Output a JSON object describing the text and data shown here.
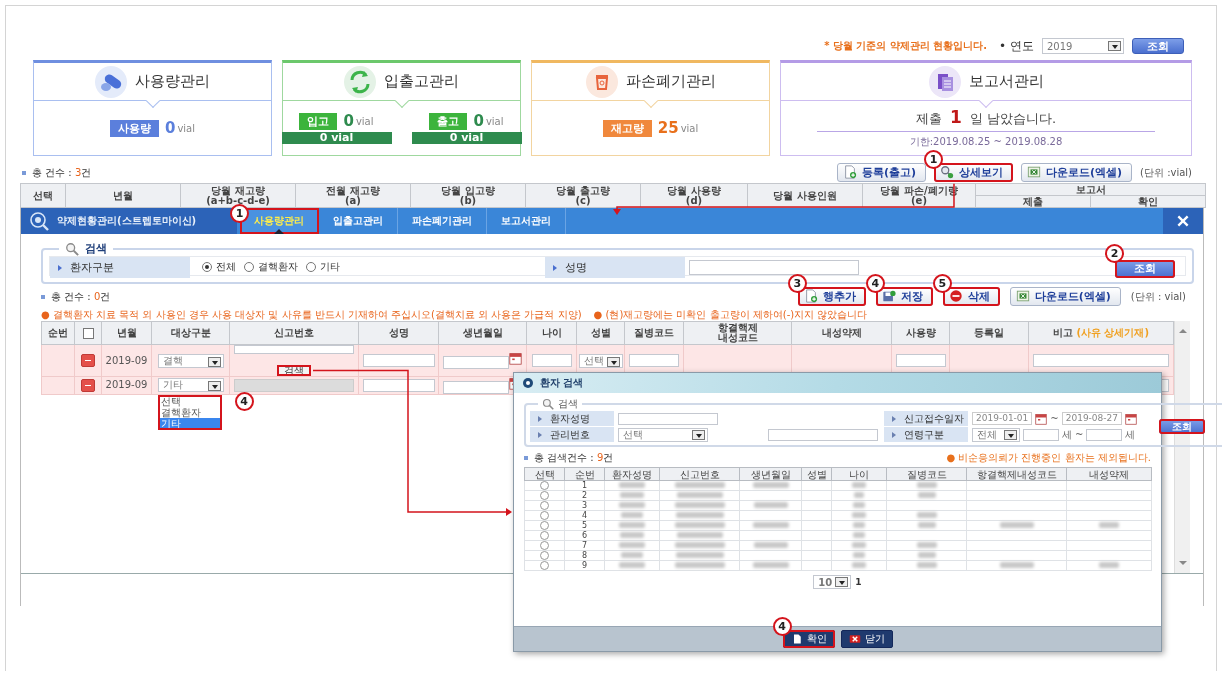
{
  "header": {
    "notice": "* 당월 기준의 약제관리 현황입니다.",
    "year_label": "• 연도",
    "year": "2019",
    "search_button": "조회"
  },
  "cards": [
    {
      "kind": "usage",
      "title": "사용량관리",
      "stats": [
        {
          "label": "사용량",
          "value": "0",
          "unit": "vial"
        }
      ]
    },
    {
      "kind": "inout",
      "title": "입출고관리",
      "stats": [
        {
          "label": "입고",
          "value": "0",
          "unit": "vial",
          "bar": "0 vial"
        },
        {
          "label": "출고",
          "value": "0",
          "unit": "vial",
          "bar": "0 vial"
        }
      ]
    },
    {
      "kind": "disposal",
      "title": "파손폐기관리",
      "stats": [
        {
          "label": "재고량",
          "value": "25",
          "unit": "vial"
        }
      ]
    },
    {
      "kind": "report",
      "title": "보고서관리",
      "message": "제출 **1** 일 남았습니다.",
      "period": "기한:2019.08.25 ~ 2019.08.28"
    }
  ],
  "summary": {
    "count_prefix": "총 건수 : ",
    "count": "3",
    "count_suffix": "건",
    "buttons": [
      {
        "kind": "register",
        "label": "등록(출고)",
        "highlighted": false
      },
      {
        "kind": "detail",
        "label": "상세보기",
        "highlighted": true,
        "callout": "1"
      },
      {
        "kind": "download",
        "label": "다운로드(엑셀)",
        "highlighted": false
      }
    ],
    "unit": "(단위 :vial)",
    "columns": [
      {
        "label": "선택"
      },
      {
        "label": "년월"
      },
      {
        "label": "당월 재고량",
        "sub": "(a+b-c-d-e)"
      },
      {
        "label": "전월 재고량",
        "sub": "(a)"
      },
      {
        "label": "당월 입고량",
        "sub": "(b)"
      },
      {
        "label": "당월 출고량",
        "sub": "(c)"
      },
      {
        "label": "당월 사용량",
        "sub": "(d)"
      },
      {
        "label": "당월 사용인원"
      },
      {
        "label": "당월 파손/폐기량",
        "sub": "(e)"
      },
      {
        "label": "보고서",
        "children": [
          "제출",
          "확인"
        ]
      }
    ]
  },
  "layer": {
    "title": "약제현황관리(스트렙토마이신)",
    "tabs": [
      {
        "label": "사용량관리",
        "selected": true,
        "highlighted": true,
        "callout": "1"
      },
      {
        "label": "입출고관리",
        "selected": false,
        "highlighted": false
      },
      {
        "label": "파손폐기관리",
        "selected": false,
        "highlighted": false
      },
      {
        "label": "보고서관리",
        "selected": false,
        "highlighted": false
      }
    ],
    "search": {
      "legend": "검색",
      "type_label": "환자구분",
      "types": [
        {
          "label": "전체",
          "selected": true
        },
        {
          "label": "결핵환자",
          "selected": false
        },
        {
          "label": "기타",
          "selected": false
        }
      ],
      "name_label": "성명",
      "button": {
        "label": "조회",
        "highlighted": true,
        "callout": "2"
      }
    },
    "count_prefix": "총 건수 : ",
    "count": "0",
    "count_suffix": "건",
    "buttons": [
      {
        "kind": "insert",
        "label": "행추가",
        "highlighted": true,
        "callout": "3"
      },
      {
        "kind": "save",
        "label": "저장",
        "highlighted": true,
        "callout": "4"
      },
      {
        "kind": "delete",
        "label": "삭제",
        "highlighted": true,
        "callout": "5"
      },
      {
        "kind": "download",
        "label": "다운로드(엑셀)",
        "highlighted": false
      }
    ],
    "unit": "(단위 : vial)",
    "notes": [
      "● 결핵환자 치료 목적 외 사용인 경우 사용 대상자 및 사유를 반드시 기재하여 주십시오(결핵치료 외 사용은 가급적 지양)",
      "● (현)재고량에는 미확인 출고량이 제하여(-)지지 않았습니다"
    ],
    "columns": [
      {
        "kind": "text",
        "label": "순번"
      },
      {
        "kind": "checkbox",
        "checked": false
      },
      {
        "kind": "text",
        "label": "년월"
      },
      {
        "kind": "text",
        "label": "대상구분"
      },
      {
        "kind": "text",
        "label": "신고번호"
      },
      {
        "kind": "text",
        "label": "성명"
      },
      {
        "kind": "text",
        "label": "생년월일"
      },
      {
        "kind": "text",
        "label": "나이"
      },
      {
        "kind": "text",
        "label": "성별"
      },
      {
        "kind": "text",
        "label": "질병코드"
      },
      {
        "kind": "text",
        "label": "항결핵제\n내성코드"
      },
      {
        "kind": "text",
        "label": "내성약제"
      },
      {
        "kind": "text",
        "label": "사용량"
      },
      {
        "kind": "text",
        "label": "등록일"
      },
      {
        "kind": "text",
        "label": "비고",
        "note": "(사유 상세기재)"
      }
    ],
    "rows": [
      {
        "year_month": "2019-09",
        "target": "결핵",
        "report_disabled": false,
        "search_button": {
          "label": "검색",
          "highlighted": true
        },
        "gender": "선택"
      },
      {
        "year_month": "2019-09",
        "target": "기타",
        "report_disabled": true,
        "dropdown": {
          "highlighted": true,
          "callout": "4",
          "options": [
            {
              "label": "선택",
              "selected": false
            },
            {
              "label": "결핵환자",
              "selected": false
            },
            {
              "label": "기타",
              "selected": true
            }
          ]
        }
      }
    ]
  },
  "popup": {
    "title": "환자 검색",
    "legend": "검색",
    "name_label": "환자성명",
    "date_label": "신고접수일자",
    "date_from": "2019-01-01",
    "date_sep": "~",
    "date_to": "2019-08-27",
    "id_label": "관리번호",
    "id_select": "선택",
    "age_label": "연령구분",
    "age_select": "전체",
    "age_from_unit": "세",
    "age_sep": "~",
    "age_to_unit": "세",
    "button": {
      "label": "조회",
      "highlighted": true
    },
    "count_prefix": "총 검색건수 : ",
    "count": "9",
    "count_suffix": "건",
    "note": "● 비순응의뢰가 진행중인 환자는 제외됩니다.",
    "columns": [
      "선택",
      "순번",
      "환자성명",
      "신고번호",
      "생년월일",
      "성별",
      "나이",
      "질병코드",
      "항결핵제내성코드",
      "내성약제"
    ],
    "rows": [
      {
        "no": "1",
        "selected": false
      },
      {
        "no": "2",
        "selected": false
      },
      {
        "no": "3",
        "selected": false
      },
      {
        "no": "4",
        "selected": false
      },
      {
        "no": "5",
        "selected": false
      },
      {
        "no": "6",
        "selected": false
      },
      {
        "no": "7",
        "selected": false
      },
      {
        "no": "8",
        "selected": false
      },
      {
        "no": "9",
        "selected": false
      }
    ],
    "page_size": "10",
    "page": "1",
    "buttons": [
      {
        "kind": "confirm",
        "label": "확인",
        "highlighted": true,
        "callout": "4"
      },
      {
        "kind": "close",
        "label": "닫기",
        "highlighted": false
      }
    ]
  }
}
